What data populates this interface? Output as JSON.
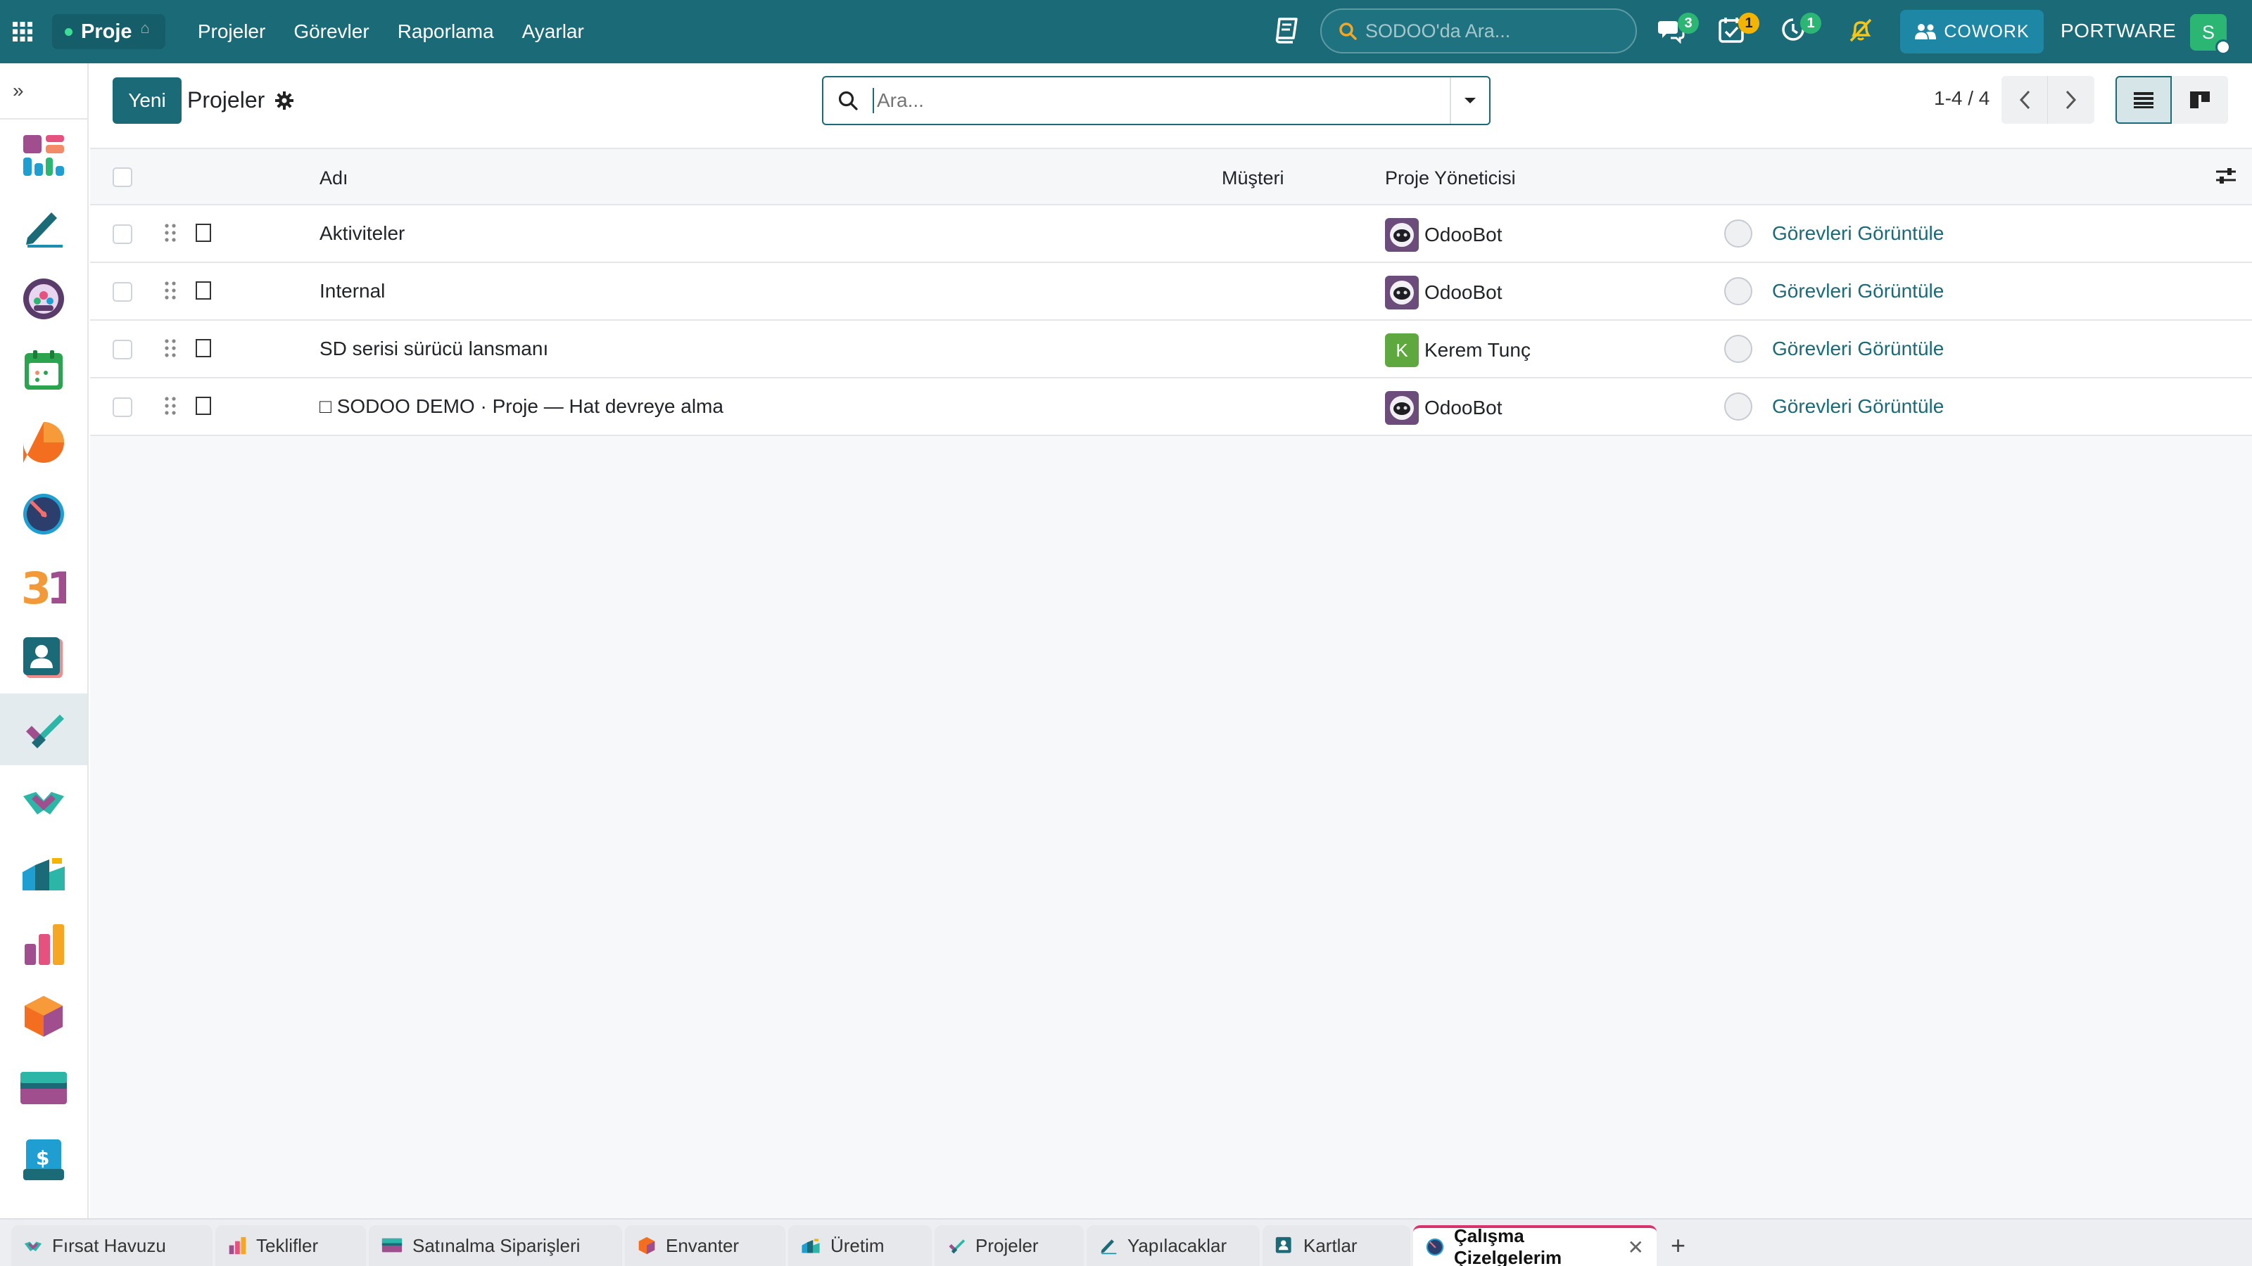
{
  "navbar": {
    "brand": "Proje",
    "menu": [
      "Projeler",
      "Görevler",
      "Raporlama",
      "Ayarlar"
    ],
    "search_placeholder": "SODOO'da Ara...",
    "badges": {
      "chat": "3",
      "activities": "1",
      "timer": "1"
    },
    "cowork_label": "COWORK",
    "company": "PORTWARE",
    "user_initial": "S"
  },
  "control_panel": {
    "new_button": "Yeni",
    "title": "Projeler",
    "search_placeholder": "Ara...",
    "pager": "1-4 / 4"
  },
  "list": {
    "headers": {
      "name": "Adı",
      "customer": "Müşteri",
      "manager": "Proje Yöneticisi"
    },
    "rows": [
      {
        "name": "Aktiviteler",
        "customer": "",
        "manager": "OdooBot",
        "manager_type": "bot",
        "action": "Görevleri Görüntüle"
      },
      {
        "name": "Internal",
        "customer": "",
        "manager": "OdooBot",
        "manager_type": "bot",
        "action": "Görevleri Görüntüle"
      },
      {
        "name": "SD serisi sürücü lansmanı",
        "customer": "",
        "manager": "Kerem Tunç",
        "manager_type": "initial",
        "manager_initial": "K",
        "action": "Görevleri Görüntüle"
      },
      {
        "name": "□ SODOO DEMO · Proje — Hat devreye alma",
        "customer": "",
        "manager": "OdooBot",
        "manager_type": "bot",
        "action": "Görevleri Görüntüle"
      }
    ]
  },
  "bottom_tabs": [
    {
      "label": "Fırsat Havuzu",
      "icon": "crm-icon"
    },
    {
      "label": "Teklifler",
      "icon": "sales-icon"
    },
    {
      "label": "Satınalma Siparişleri",
      "icon": "purchase-icon"
    },
    {
      "label": "Envanter",
      "icon": "inventory-icon"
    },
    {
      "label": "Üretim",
      "icon": "manufacturing-icon"
    },
    {
      "label": "Projeler",
      "icon": "project-icon"
    },
    {
      "label": "Yapılacaklar",
      "icon": "todo-icon"
    },
    {
      "label": "Kartlar",
      "icon": "contacts-icon"
    },
    {
      "label": "Çalışma Çizelgelerim",
      "icon": "timesheet-icon",
      "active": true
    }
  ],
  "colors": {
    "brand": "#1a6a77",
    "link": "#1a6a77",
    "badge_green": "#2bb673",
    "badge_yellow": "#f5b400"
  }
}
